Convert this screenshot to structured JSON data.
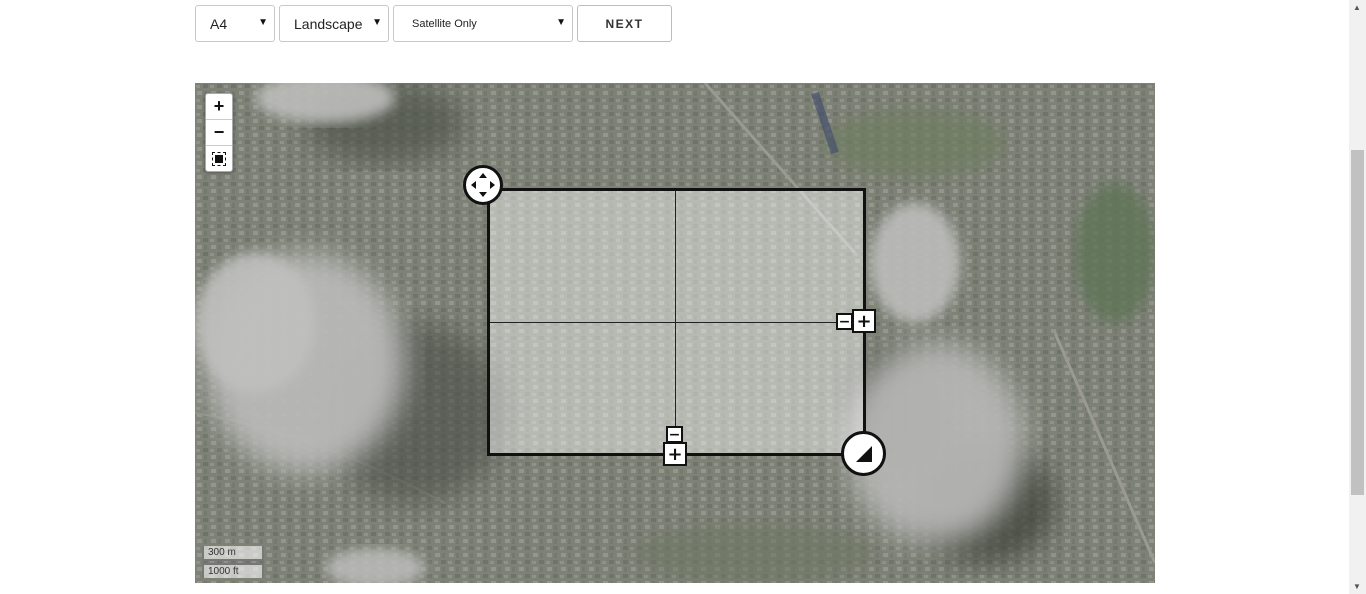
{
  "toolbar": {
    "paper_size": "A4",
    "orientation": "Landscape",
    "layer": "Satellite Only",
    "next_label": "NEXT"
  },
  "map": {
    "zoom_in_label": "+",
    "zoom_out_label": "−",
    "scale_metric": "300 m",
    "scale_imperial": "1000 ft"
  },
  "frame": {
    "minus_label": "−",
    "plus_label": "+"
  }
}
